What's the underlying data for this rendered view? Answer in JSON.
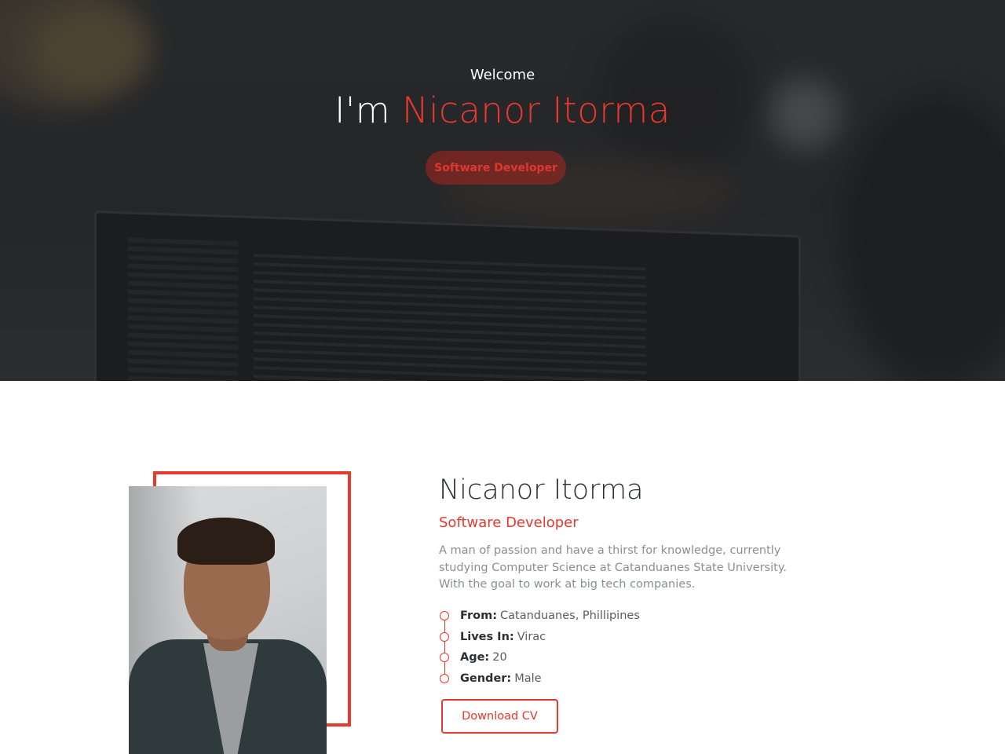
{
  "hero": {
    "welcome": "Welcome",
    "title_prefix": "I'm ",
    "title_name": "Nicanor Itorma",
    "badge": "Software Developer"
  },
  "about": {
    "name": "Nicanor Itorma",
    "role": "Software Developer",
    "description": "A man of passion and have a thirst for knowledge, currently studying Computer Science at Catanduanes State University. With the goal to work at big tech companies.",
    "info": [
      {
        "key": "From:",
        "value": "Catanduanes, Phillipines"
      },
      {
        "key": "Lives In:",
        "value": "Virac"
      },
      {
        "key": "Age:",
        "value": "20"
      },
      {
        "key": "Gender:",
        "value": "Male"
      }
    ],
    "cv_button": "Download CV"
  },
  "colors": {
    "accent": "#e8392c",
    "hero_bg": "#2f3133",
    "text_dark": "#2b2f33",
    "text_muted": "#8a8e93"
  }
}
